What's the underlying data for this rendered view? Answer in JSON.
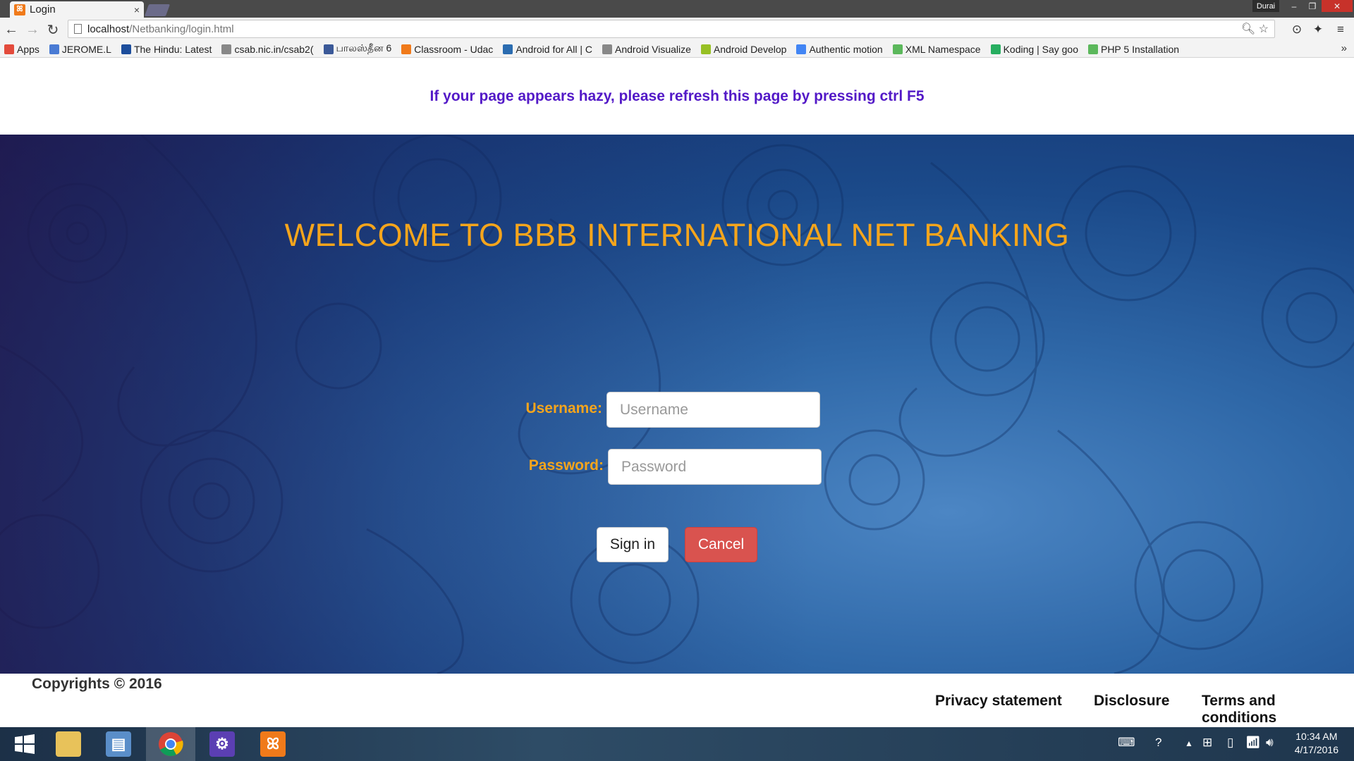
{
  "browser": {
    "tab_title": "Login",
    "tab_close": "×",
    "user_name": "Durai",
    "url_host": "localhost",
    "url_path": "/Netbanking/login.html",
    "bookmarks": [
      {
        "label": "Apps",
        "color": "#e34b3c"
      },
      {
        "label": "JEROME.L",
        "color": "#4a7bd4"
      },
      {
        "label": "The Hindu: Latest",
        "color": "#1d4e9c"
      },
      {
        "label": "csab.nic.in/csab2(",
        "color": "#888888"
      },
      {
        "label": "பாலஸ்தீன 6",
        "color": "#3b5998"
      },
      {
        "label": "Classroom - Udac",
        "color": "#f07a1a"
      },
      {
        "label": "Android for All | C",
        "color": "#2b6cb0"
      },
      {
        "label": "Android Visualize",
        "color": "#888888"
      },
      {
        "label": "Android Develop",
        "color": "#97c024"
      },
      {
        "label": "Authentic motion",
        "color": "#4285f4"
      },
      {
        "label": "XML Namespace",
        "color": "#5cb85c"
      },
      {
        "label": "Koding | Say goo",
        "color": "#27ae60"
      },
      {
        "label": "PHP 5 Installation",
        "color": "#5cb85c"
      }
    ],
    "bookmarks_more": "»"
  },
  "page": {
    "notice": "If your page appears hazy, please refresh this page by pressing ctrl F5",
    "welcome": "WELCOME TO BBB INTERNATIONAL NET BANKING",
    "username_label": "Username:",
    "username_placeholder": "Username",
    "username_value": "",
    "password_label": "Password:",
    "password_placeholder": "Password",
    "password_value": "",
    "signin_label": "Sign in",
    "cancel_label": "Cancel",
    "copyright": "Copyrights © 2016",
    "footer_links": [
      "Privacy statement",
      "Disclosure",
      "Terms and conditions"
    ]
  },
  "taskbar": {
    "time": "10:34 AM",
    "date": "4/17/2016"
  },
  "colors": {
    "accent_orange": "#f5a51c",
    "notice_purple": "#5319c7",
    "cancel_red": "#d9534f"
  }
}
